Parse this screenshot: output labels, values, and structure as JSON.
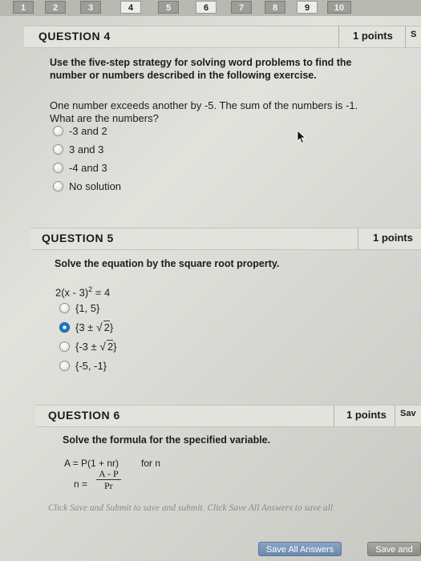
{
  "nav": {
    "tabs": [
      "1",
      "2",
      "3",
      "4",
      "5",
      "6",
      "7",
      "8",
      "9",
      "10"
    ]
  },
  "question4": {
    "title": "QUESTION 4",
    "points": "1 points",
    "save_label": "S",
    "instruction_line1": "Use the five-step strategy for solving word problems to find the",
    "instruction_line2": "number or numbers described in the following exercise.",
    "prompt_line1": "One number exceeds another by -5. The sum of the numbers is -1.",
    "prompt_line2": "What are the numbers?",
    "options": [
      "-3 and 2",
      "3 and 3",
      "-4 and 3",
      "No solution"
    ]
  },
  "question5": {
    "title": "QUESTION 5",
    "points": "1 points",
    "instruction": "Solve the equation by the square root property.",
    "equation_left": "2(x - 3)",
    "equation_exp": "2",
    "equation_right": " = 4",
    "options": [
      {
        "prefix": "{1, 5}",
        "radicand": "",
        "suffix": ""
      },
      {
        "prefix": "{3 ± ",
        "radicand": "2",
        "suffix": "}"
      },
      {
        "prefix": "{-3 ± ",
        "radicand": "2",
        "suffix": "}"
      },
      {
        "prefix": "{-5, -1}",
        "radicand": "",
        "suffix": ""
      }
    ],
    "selected_index": 1
  },
  "question6": {
    "title": "QUESTION 6",
    "points": "1 points",
    "save_label": "Sav",
    "instruction": "Solve the formula for the specified variable.",
    "formula": "A = P(1 + nr)",
    "for_var": "for n",
    "answer_lhs": "n =",
    "answer_numerator": "A - P",
    "answer_denominator": "Pr"
  },
  "footer": {
    "note": "Click Save and Submit to save and submit. Click Save All Answers to save all",
    "save_all_label": "Save All Answers",
    "save_submit_label": "Save and"
  }
}
